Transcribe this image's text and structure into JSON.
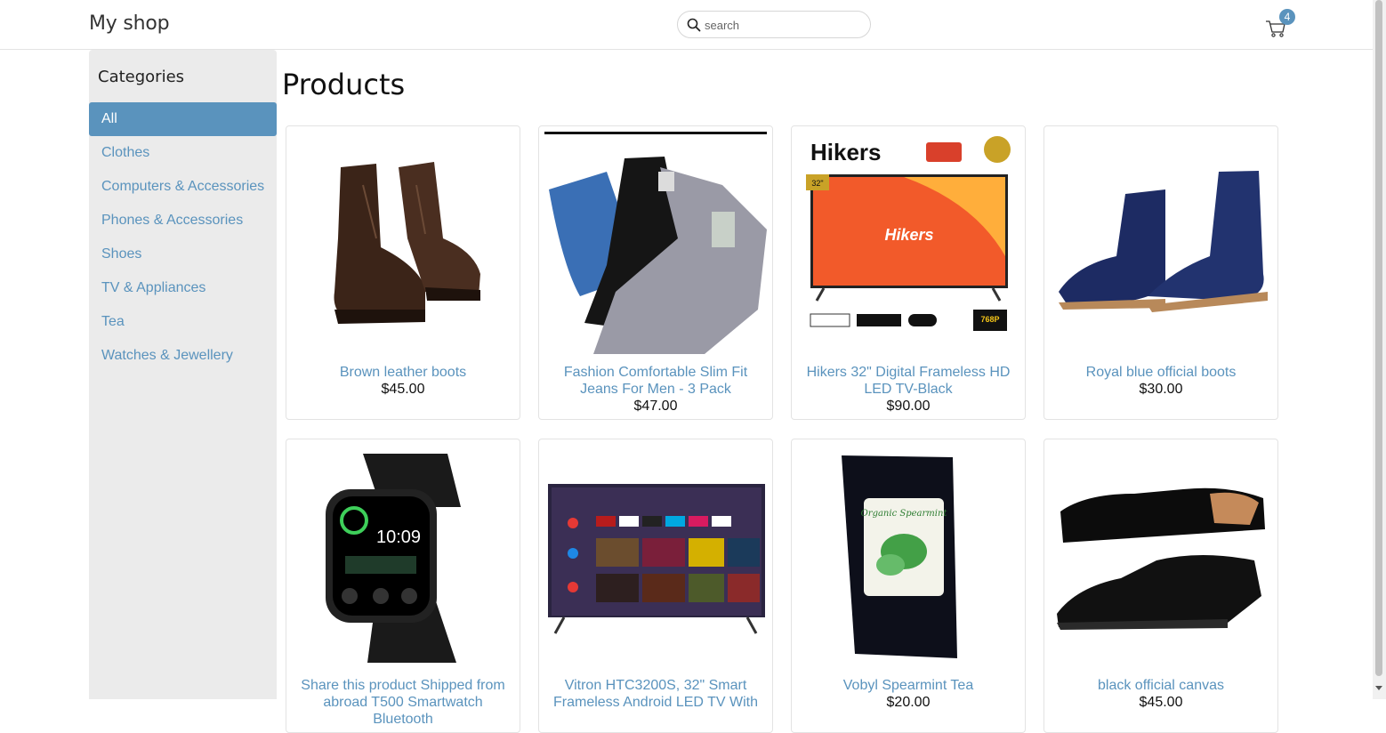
{
  "header": {
    "brand": "My shop",
    "search_placeholder": "search",
    "cart_count": "4"
  },
  "sidebar": {
    "title": "Categories",
    "items": [
      {
        "label": "All",
        "active": true
      },
      {
        "label": "Clothes"
      },
      {
        "label": "Computers & Accessories"
      },
      {
        "label": "Phones & Accessories"
      },
      {
        "label": "Shoes"
      },
      {
        "label": "TV & Appliances"
      },
      {
        "label": "Tea"
      },
      {
        "label": "Watches & Jewellery"
      }
    ]
  },
  "main": {
    "title": "Products",
    "products": [
      {
        "name": "Brown leather boots",
        "price": "$45.00",
        "image": "brown-boots-image"
      },
      {
        "name": "Fashion Comfortable Slim Fit Jeans For Men - 3 Pack",
        "price": "$47.00",
        "image": "jeans-image"
      },
      {
        "name": "Hikers 32\" Digital Frameless HD LED TV-Black",
        "price": "$90.00",
        "image": "tv-image",
        "image_text": {
          "brand": "Hikers",
          "size": "32\"",
          "res": "768P"
        }
      },
      {
        "name": "Royal blue official boots",
        "price": "$30.00",
        "image": "blue-boots-image"
      },
      {
        "name": "Share this product Shipped from abroad T500 Smartwatch Bluetooth",
        "price": "",
        "image": "smartwatch-image",
        "image_text": {
          "time": "10:09"
        }
      },
      {
        "name": "Vitron HTC3200S, 32\" Smart Frameless Android LED TV With",
        "price": "",
        "image": "smart-tv-image"
      },
      {
        "name": "Vobyl Spearmint Tea",
        "price": "$20.00",
        "image": "tea-image",
        "image_text": {
          "label": "Organic Spearmint"
        }
      },
      {
        "name": "black official canvas",
        "price": "$45.00",
        "image": "black-shoes-image"
      }
    ]
  },
  "colors": {
    "accent": "#5a93bd",
    "sidebar_bg": "#ebebeb"
  }
}
